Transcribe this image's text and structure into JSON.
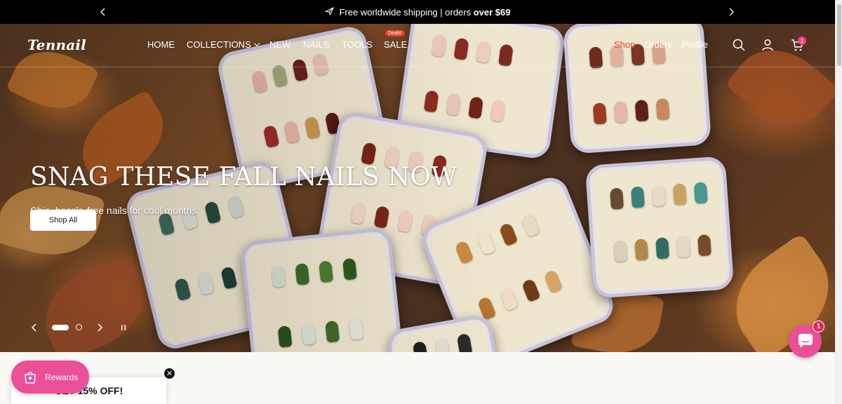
{
  "announcement": {
    "text": "Free worldwide shipping | orders ",
    "bold": "over $69"
  },
  "header": {
    "logo": "Tennail",
    "nav": [
      {
        "label": "HOME"
      },
      {
        "label": "COLLECTIONS"
      },
      {
        "label": "NEW"
      },
      {
        "label": "NAILS"
      },
      {
        "label": "TOOLS"
      },
      {
        "label": "SALE",
        "badge": "Deals!"
      }
    ],
    "links": {
      "shop": "Shop",
      "orders": "Orders",
      "profile": "Profile"
    },
    "cart_count": "1",
    "accent": "#e2432a"
  },
  "hero": {
    "title": "SNAG THESE FALL NAILS NOW",
    "subtitle": "Chic, hassle-free nails for cool months",
    "cta": "Shop All",
    "slide_current": 1,
    "slide_total": 2
  },
  "rewards": {
    "label": "Rewards",
    "color": "#ea4f98"
  },
  "promo": {
    "text": "GET 15% OFF!"
  },
  "chat": {
    "badge": "1"
  }
}
